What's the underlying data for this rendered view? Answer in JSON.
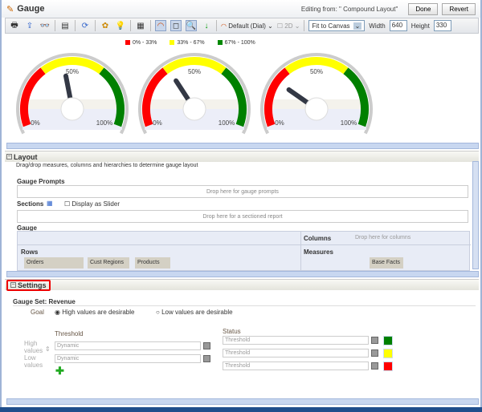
{
  "header": {
    "title": "Gauge",
    "editing": "Editing from: \" Compound Layout\"",
    "done": "Done",
    "revert": "Revert"
  },
  "toolbar": {
    "style": "Default (Dial)",
    "dim": "2D",
    "fit": "Fit to Canvas",
    "width_label": "Width",
    "width": "640",
    "height_label": "Height",
    "height": "330"
  },
  "chart_data": {
    "type": "gauge",
    "min": 0,
    "max": 100,
    "legend": [
      {
        "label": "0% - 33%",
        "color": "#ff0000"
      },
      {
        "label": "33% - 67%",
        "color": "#ffff00"
      },
      {
        "label": "67% - 100%",
        "color": "#008000"
      }
    ],
    "tick_labels": [
      "0%",
      "50%",
      "100%"
    ],
    "values": [
      45,
      35,
      25
    ]
  },
  "layout": {
    "header": "Layout",
    "desc": "Drag/drop measures, columns and hierarchies to determine gauge layout",
    "prompts": "Gauge Prompts",
    "prompts_drop": "Drop here for gauge prompts",
    "sections": "Sections",
    "slider": "Display as Slider",
    "sections_drop": "Drop here for a sectioned report",
    "gauge": "Gauge",
    "columns": "Columns",
    "columns_drop": "Drop here for columns",
    "rows": "Rows",
    "row_items": [
      "Orders",
      "Cust Regions",
      "Products"
    ],
    "measures": "Measures",
    "measure_items": [
      "Base Facts"
    ]
  },
  "settings": {
    "header": "Settings",
    "gauge_set": "Gauge Set: Revenue",
    "goal": "Goal",
    "high": "High values are desirable",
    "low": "Low values are desirable",
    "threshold": "Threshold",
    "status": "Status",
    "high_values": "High values",
    "low_values": "Low values",
    "thresholds": [
      "Dynamic",
      "Dynamic"
    ],
    "status_rows": [
      {
        "text": "Threshold",
        "color": "#008000"
      },
      {
        "text": "Threshold",
        "color": "#ffff00"
      },
      {
        "text": "Threshold",
        "color": "#ff0000"
      }
    ]
  }
}
